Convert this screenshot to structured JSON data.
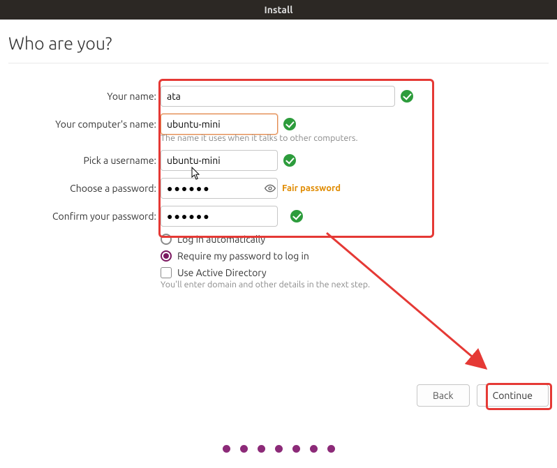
{
  "window": {
    "title": "Install"
  },
  "heading": "Who are you?",
  "labels": {
    "name": "Your name:",
    "computer": "Your computer's name:",
    "username": "Pick a username:",
    "password": "Choose a password:",
    "confirm": "Confirm your password:"
  },
  "fields": {
    "name": "ata",
    "computer": "ubuntu-mini",
    "username": "ubuntu-mini",
    "password": "●●●●●●",
    "confirm": "●●●●●●"
  },
  "hints": {
    "computer": "The name it uses when it talks to other computers.",
    "ad": "You'll enter domain and other details in the next step."
  },
  "password_strength": "Fair password",
  "options": {
    "auto_login": "Log in automatically",
    "require_pw": "Require my password to log in",
    "use_ad": "Use Active Directory",
    "selected": "require_pw",
    "use_ad_checked": false
  },
  "buttons": {
    "back": "Back",
    "continue": "Continue"
  },
  "progress": {
    "total_dots": 7
  }
}
